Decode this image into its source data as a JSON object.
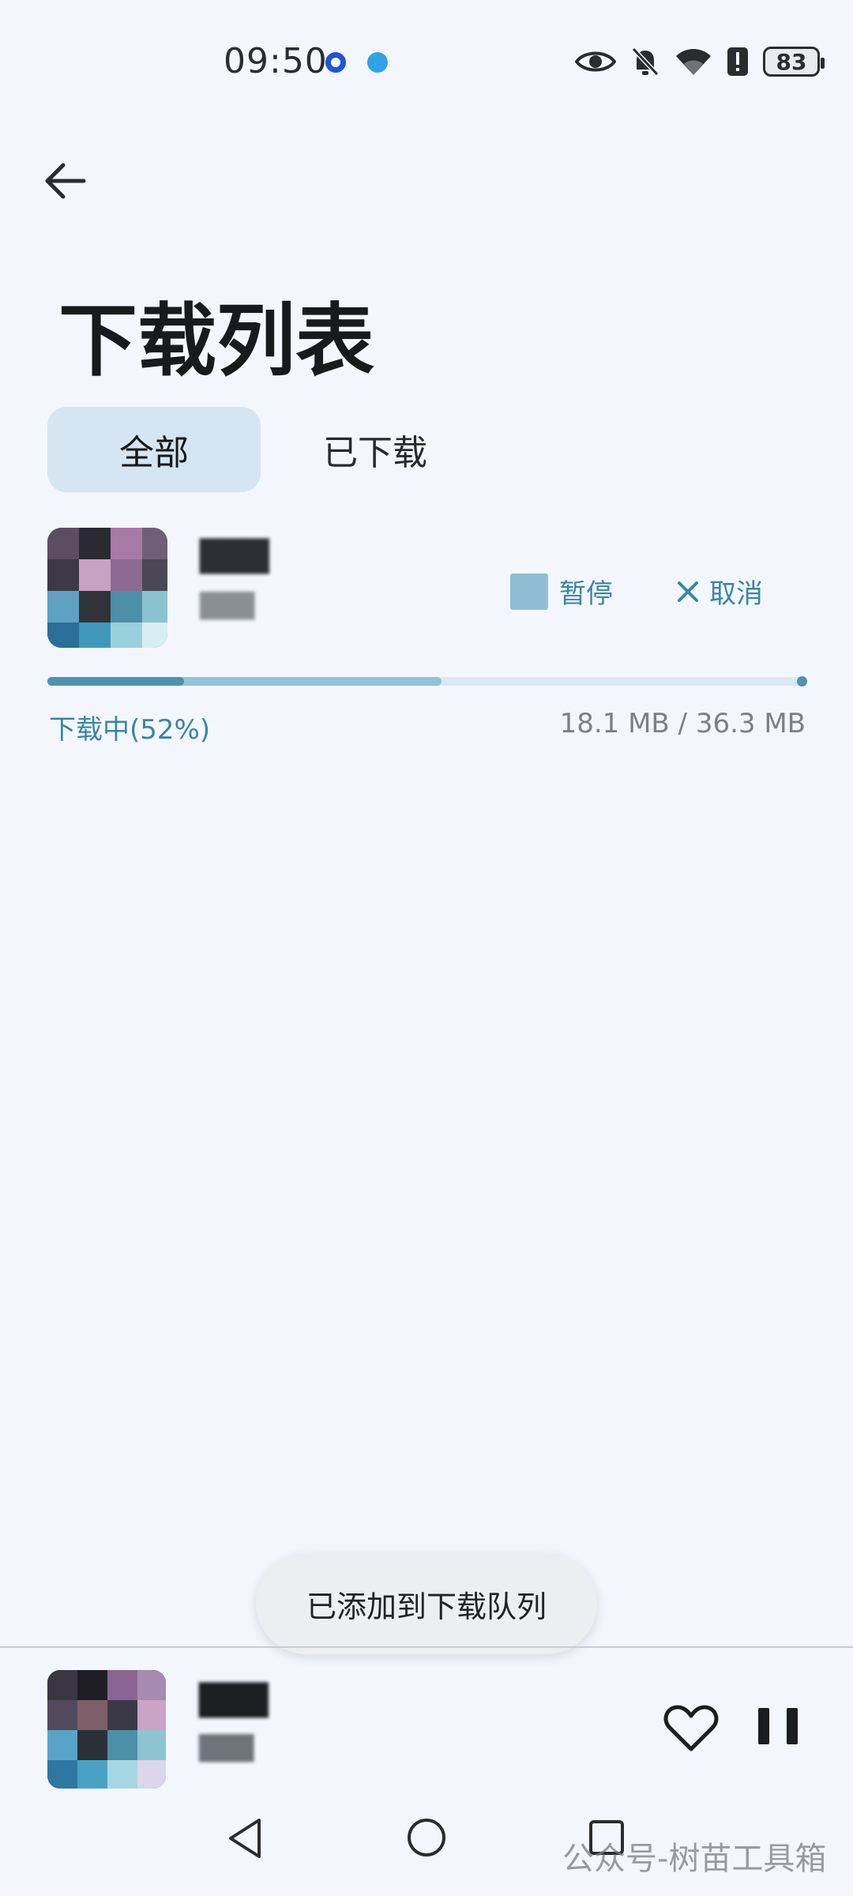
{
  "status_bar": {
    "time": "09:50",
    "battery": "83",
    "icons": [
      "eye-icon",
      "bell-off-icon",
      "wifi-icon",
      "alert-icon"
    ]
  },
  "header": {
    "title": "下载列表",
    "back_icon": "arrow-left-icon"
  },
  "tabs": [
    {
      "label": "全部",
      "active": true
    },
    {
      "label": "已下载",
      "active": false
    }
  ],
  "download_item": {
    "title": "███",
    "artist": "███",
    "pause_label": "暂停",
    "cancel_label": "取消",
    "status": "下载中(52%)",
    "size": "18.1 MB / 36.3 MB",
    "progress": 0.18,
    "buffer": 0.52
  },
  "toast": {
    "text": "已添加到下载队列"
  },
  "mini_player": {
    "title": "███",
    "artist": "███",
    "heart_icon": "heart-outline-icon",
    "pause_icon": "pause-icon"
  },
  "nav": {
    "back_icon": "triangle-back-icon",
    "home_icon": "circle-home-icon",
    "recent_icon": "square-recent-icon"
  },
  "watermark": "公众号-树苗工具箱",
  "colors": {
    "background": "#f3f7fd",
    "accent": "#3a85a7",
    "tab_active_bg": "#d5e6f2",
    "progress_fill": "#4f92ad",
    "progress_buffer": "#92c2d6",
    "progress_track": "#d8e9f1"
  }
}
